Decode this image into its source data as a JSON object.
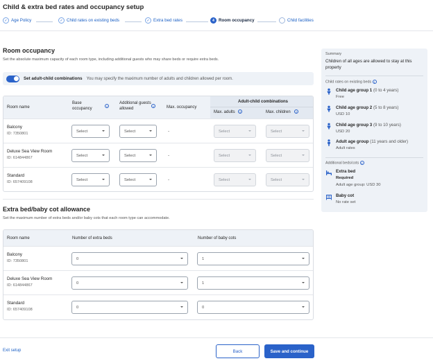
{
  "page_title": "Child & extra bed rates and occupancy setup",
  "steps": [
    {
      "label": "Age Policy",
      "state": "done"
    },
    {
      "label": "Child rates on existing beds",
      "state": "done"
    },
    {
      "label": "Extra bed rates",
      "state": "done"
    },
    {
      "label": "Room occupancy",
      "state": "active",
      "number": "4"
    },
    {
      "label": "Child facilities",
      "state": "todo"
    }
  ],
  "occupancy": {
    "title": "Room occupancy",
    "description": "Set the absolute maximum capacity of each room type, including additional guests who may share beds or require extra beds.",
    "toggle_label": "Set adult-child combinations",
    "toggle_description": "You may specify the maximum number of adults and children allowed per room.",
    "toggle_on": true,
    "headers": {
      "room_name": "Room name",
      "base_occupancy": "Base occupancy",
      "additional_guests": "Additional guests allowed",
      "max_occupancy": "Max. occupancy",
      "adult_child": "Adult-child combinations",
      "max_adults": "Max. adults",
      "max_children": "Max. children"
    },
    "rows": [
      {
        "name": "Balcony",
        "id": "ID: 7350801",
        "base": "Select",
        "additional": "Select",
        "max": "-",
        "adults": "Select",
        "children": "Select"
      },
      {
        "name": "Deluxe Sea View Room",
        "id": "ID: 614844867",
        "base": "Select",
        "additional": "Select",
        "max": "-",
        "adults": "Select",
        "children": "Select"
      },
      {
        "name": "Standard",
        "id": "ID: 657409108",
        "base": "Select",
        "additional": "Select",
        "max": "-",
        "adults": "Select",
        "children": "Select"
      }
    ]
  },
  "extra_bed": {
    "title": "Extra bed/baby cot allowance",
    "description": "Set the maximum number of extra beds and/or baby cots that each room type can accommodate.",
    "headers": {
      "room_name": "Room name",
      "extra_beds": "Number of extra beds",
      "baby_cots": "Number of baby cots"
    },
    "rows": [
      {
        "name": "Balcony",
        "id": "ID: 7350801",
        "extra_beds": "0",
        "baby_cots": "1"
      },
      {
        "name": "Deluxe Sea View Room",
        "id": "ID: 614844867",
        "extra_beds": "0",
        "baby_cots": "1"
      },
      {
        "name": "Standard",
        "id": "ID: 657409108",
        "extra_beds": "0",
        "baby_cots": "0"
      }
    ]
  },
  "summary": {
    "heading": "Summary",
    "text": "Children of all ages are allowed to stay at this property",
    "child_rates_label": "Child rates on existing beds",
    "child_groups": [
      {
        "name": "Child age group 1",
        "range": "(0 to 4 years)",
        "rate": "Free",
        "icon": "child-icon"
      },
      {
        "name": "Child age group 2",
        "range": "(5 to 8 years)",
        "rate": "USD 10",
        "icon": "child-icon"
      },
      {
        "name": "Child age group 3",
        "range": "(9 to 10 years)",
        "rate": "USD 20",
        "icon": "child-icon"
      },
      {
        "name": "Adult age group",
        "range": "(11 years and older)",
        "rate": "Adult rates",
        "icon": "adult-icon"
      }
    ],
    "additional_label": "Additional beds/cots",
    "extra_bed": {
      "name": "Extra bed",
      "status": "Required",
      "detail": "Adult age group: USD 30",
      "icon": "bed-icon"
    },
    "baby_cot": {
      "name": "Baby cot",
      "detail": "No rate set",
      "icon": "crib-icon"
    }
  },
  "footer": {
    "exit": "Exit setup",
    "back": "Back",
    "save": "Save and continue"
  },
  "colors": {
    "accent": "#2a62c9",
    "panel": "#eef2f7",
    "border": "#d9dde3"
  }
}
